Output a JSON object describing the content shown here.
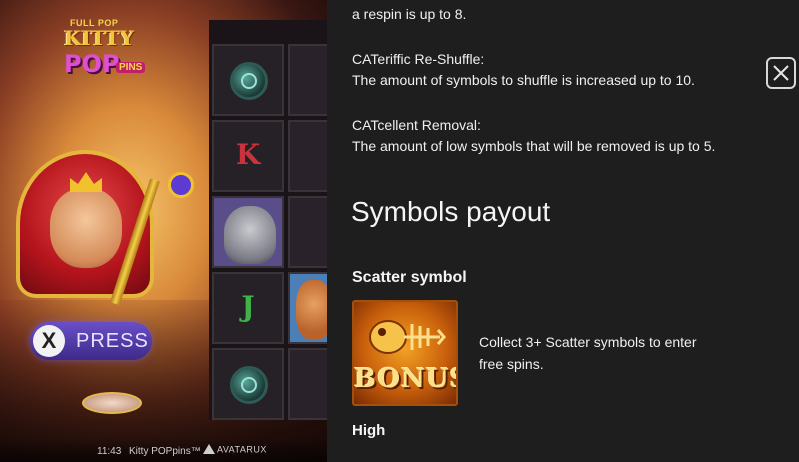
{
  "game": {
    "logo": {
      "line1": "FULL POP",
      "line2": "KITTY",
      "line3": "POP",
      "line4": "PINS"
    },
    "xpress_button": {
      "icon": "X",
      "label": "PRESS"
    },
    "reels": {
      "col1": [
        "orb",
        "K",
        "cat",
        "J",
        "orb"
      ],
      "col2_visible": [
        "",
        "",
        "",
        "",
        ""
      ]
    }
  },
  "statusbar": {
    "time": "11:43",
    "title": "Kitty POPpins™",
    "provider": "AVATARUX"
  },
  "panel": {
    "lines": {
      "respin_tail": "a respin is up to 8.",
      "reshuffle_title": "CATeriffic Re-Shuffle:",
      "reshuffle_desc": "The amount of symbols to shuffle is increased up to 10.",
      "removal_title": "CATcellent Removal:",
      "removal_desc": "The amount of low symbols that will be removed is up to 5."
    },
    "heading": "Symbols payout",
    "scatter": {
      "title": "Scatter symbol",
      "symbol_text": "BONUS",
      "desc_line1": "Collect 3+ Scatter symbols to enter",
      "desc_line2": "free spins."
    },
    "high_title": "High",
    "close_icon": "close-icon"
  }
}
